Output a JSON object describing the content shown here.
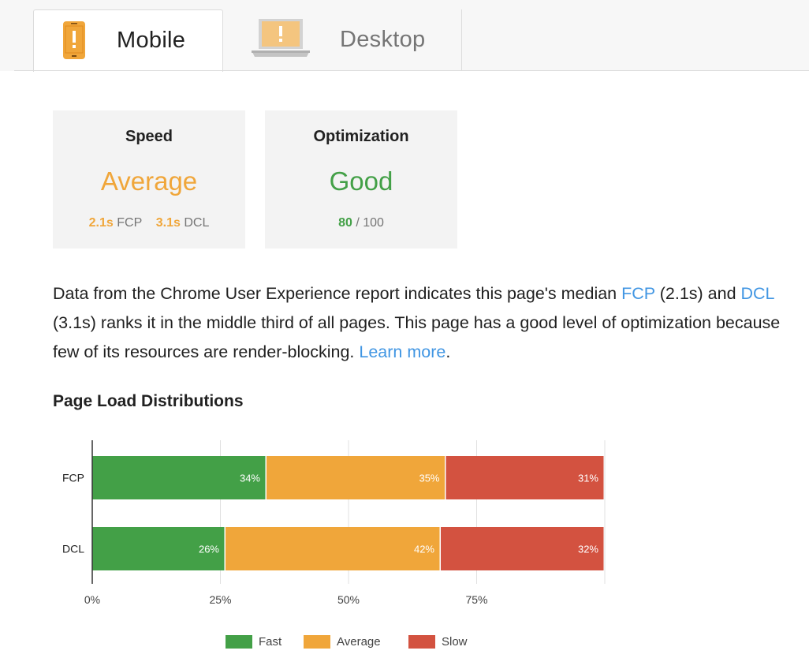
{
  "tabs": [
    {
      "label": "Mobile",
      "icon": "mobile-phone-icon",
      "active": true
    },
    {
      "label": "Desktop",
      "icon": "laptop-icon",
      "active": false
    }
  ],
  "colors": {
    "fast": "#43a047",
    "average": "#f0a63a",
    "slow": "#d35240",
    "link": "#4196e3",
    "card_bg": "#f3f3f3"
  },
  "speed_card": {
    "title": "Speed",
    "rating": "Average",
    "fcp_value": "2.1s",
    "fcp_label": "FCP",
    "dcl_value": "3.1s",
    "dcl_label": "DCL"
  },
  "optimization_card": {
    "title": "Optimization",
    "rating": "Good",
    "score": "80",
    "score_max": "/ 100"
  },
  "description": {
    "part1": "Data from the Chrome User Experience report indicates this page's median ",
    "fcp_link": "FCP",
    "part2": " (2.1s) and ",
    "dcl_link": "DCL",
    "part3": " (3.1s) ranks it in the middle third of all pages. This page has a good level of optimization because few of its resources are render-blocking. ",
    "learn_more": "Learn more",
    "part4": "."
  },
  "chart_title": "Page Load Distributions",
  "chart_data": {
    "type": "bar",
    "orientation": "horizontal",
    "stacked": true,
    "categories": [
      "FCP",
      "DCL"
    ],
    "series": [
      {
        "name": "Fast",
        "values": [
          34,
          26
        ],
        "labels": [
          "34%",
          "26%"
        ]
      },
      {
        "name": "Average",
        "values": [
          35,
          42
        ],
        "labels": [
          "35%",
          "42%"
        ]
      },
      {
        "name": "Slow",
        "values": [
          31,
          32
        ],
        "labels": [
          "31%",
          "32%"
        ]
      }
    ],
    "x_ticks": [
      "0%",
      "25%",
      "50%",
      "75%"
    ],
    "xlim": [
      0,
      100
    ],
    "grid": true,
    "legend": "bottom"
  }
}
